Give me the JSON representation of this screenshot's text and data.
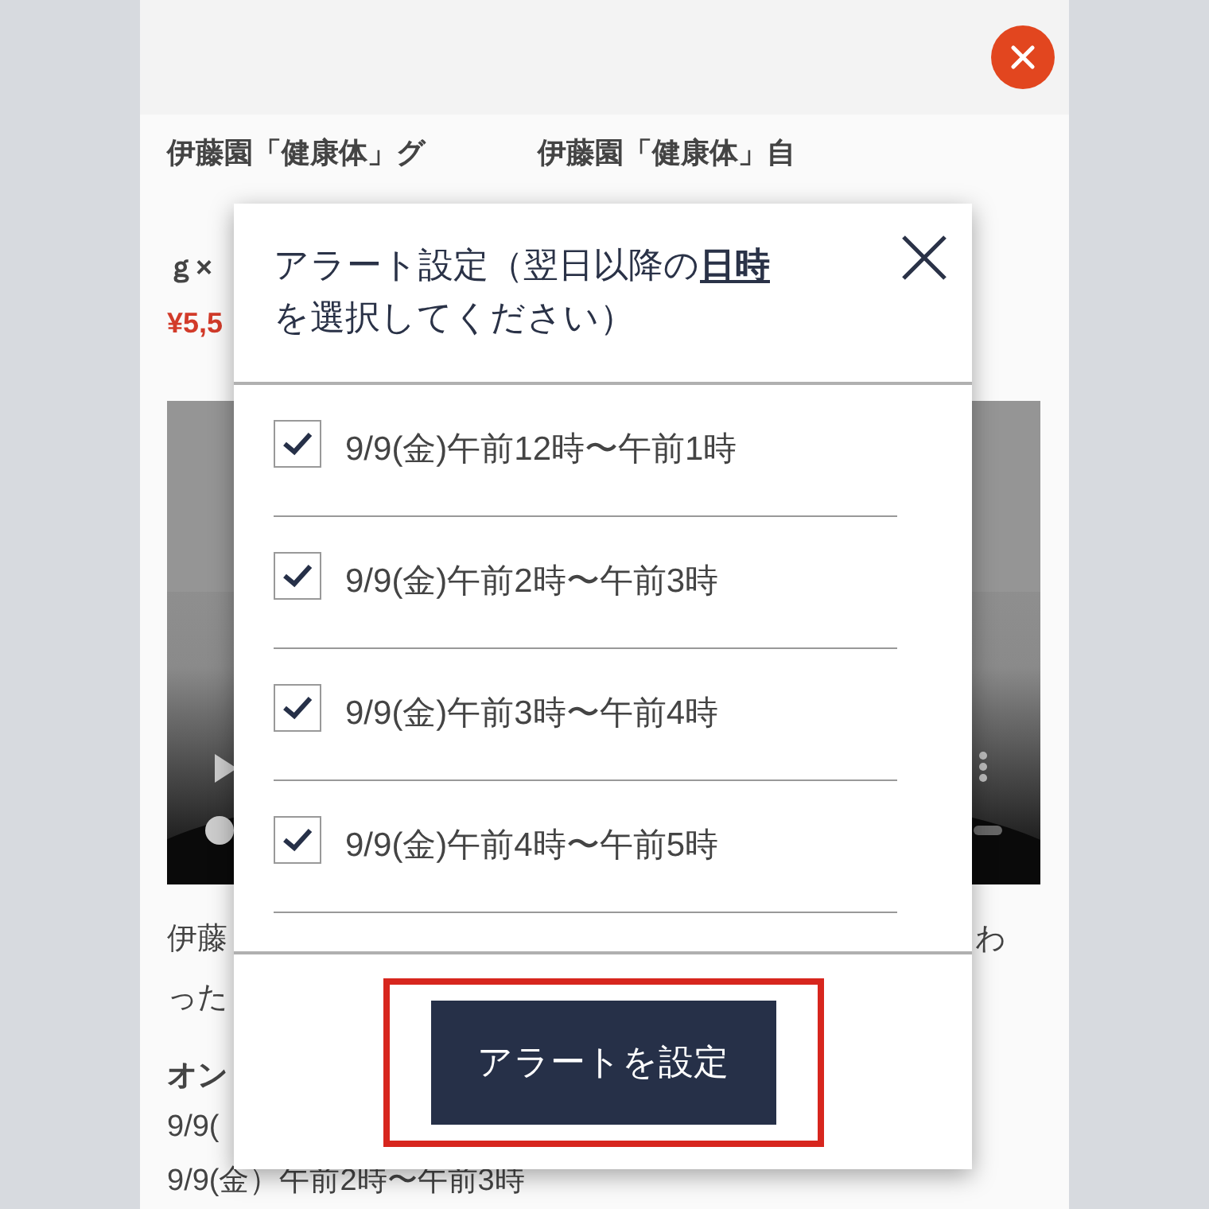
{
  "page": {
    "products": [
      {
        "title_lines": [
          "伊藤園「健康体」グ",
          "ｇ×"
        ],
        "price": "¥5,5"
      },
      {
        "title_lines": [
          "伊藤園「健康体」自"
        ]
      }
    ],
    "description": [
      {
        "left": "伊藤",
        "right": "わ"
      },
      {
        "left": "った"
      }
    ],
    "heading": "オン",
    "schedule": [
      "9/9(",
      "9/9(金）午前2時〜午前3時"
    ]
  },
  "modal": {
    "title_lines": [
      "アラート設定（翌日以降の**日時**",
      "を選択してください）"
    ],
    "options": [
      {
        "label": "9/9(金)午前12時〜午前1時",
        "checked": true
      },
      {
        "label": "9/9(金)午前2時〜午前3時",
        "checked": true
      },
      {
        "label": "9/9(金)午前3時〜午前4時",
        "checked": true
      },
      {
        "label": "9/9(金)午前4時〜午前5時",
        "checked": true
      }
    ],
    "submit": "アラートを設定",
    "highlighted": true
  }
}
